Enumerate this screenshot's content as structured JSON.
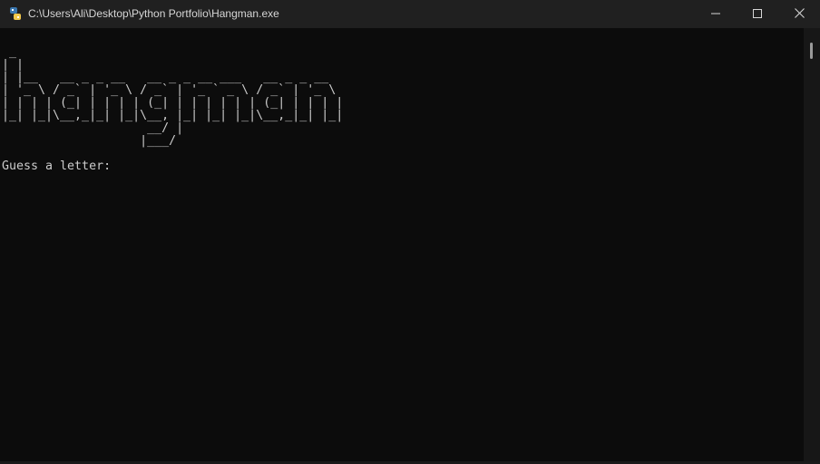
{
  "window": {
    "title": "C:\\Users\\Ali\\Desktop\\Python Portfolio\\Hangman.exe",
    "icon": "python-icon",
    "controls": {
      "minimize_icon": "minimize-icon",
      "maximize_icon": "maximize-icon",
      "close_icon": "close-icon"
    }
  },
  "console": {
    "banner": " _                                             \n| |                                            \n| |__   __ _ _ __   __ _ _ __ ___   __ _ _ __  \n| '_ \\ / _` | '_ \\ / _` | '_ ` _ \\ / _` | '_ \\ \n| | | | (_| | | | | (_| | | | | | | (_| | | | |\n|_| |_|\\__,_|_| |_|\\__, |_| |_| |_|\\__,_|_| |_|\n                    __/ |                      \n                   |___/                       ",
    "prompt": "Guess a letter:",
    "colors": {
      "background": "#0c0c0c",
      "foreground": "#cccccc"
    }
  }
}
